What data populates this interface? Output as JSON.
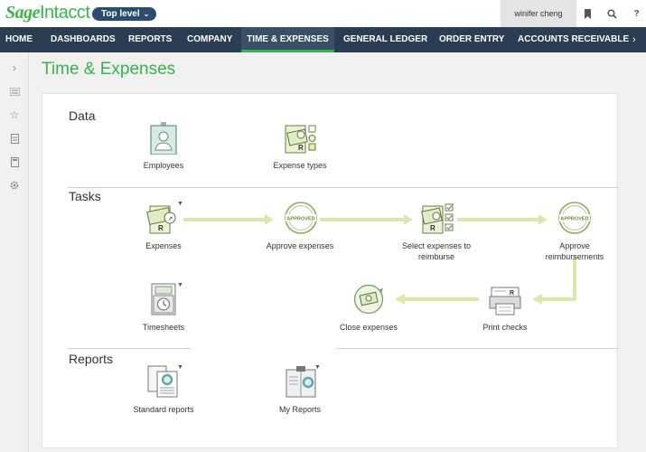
{
  "header": {
    "logo_sage": "Sage",
    "logo_intacct": "Intacct",
    "level_label": "Top level",
    "user_name": "winifer cheng"
  },
  "nav": {
    "items": [
      "HOME",
      "DASHBOARDS",
      "REPORTS",
      "COMPANY",
      "TIME & EXPENSES",
      "GENERAL LEDGER",
      "ORDER ENTRY",
      "ACCOUNTS RECEIVABLE"
    ],
    "active": "TIME & EXPENSES"
  },
  "page": {
    "title": "Time & Expenses"
  },
  "sections": {
    "data": {
      "title": "Data",
      "items": [
        "Employees",
        "Expense types"
      ]
    },
    "tasks": {
      "title": "Tasks",
      "expenses": "Expenses",
      "approve_expenses": "Approve expenses",
      "select_line1": "Select expenses to",
      "select_line2": "reimburse",
      "approve_reimb_line1": "Approve",
      "approve_reimb_line2": "reimbursements",
      "timesheets": "Timesheets",
      "close_expenses": "Close expenses",
      "print_checks": "Print checks",
      "stamp_text": "APPROVED"
    },
    "reports": {
      "title": "Reports",
      "items": [
        "Standard reports",
        "My Reports"
      ]
    }
  },
  "colors": {
    "brand_green": "#36b34a",
    "nav_bg": "#2a3d52",
    "arrow": "#d8e9a8"
  }
}
